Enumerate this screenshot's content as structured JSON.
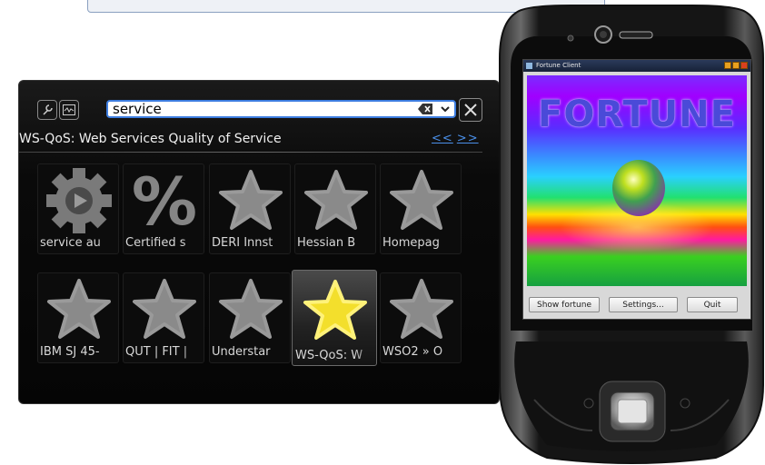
{
  "launcher": {
    "search_value": "service",
    "description": "WS-QoS: Web Services Quality of Service",
    "pager_prev": "<<",
    "pager_next": ">>",
    "items": [
      {
        "label": "service au",
        "icon": "gear-play"
      },
      {
        "label": "Certified s",
        "icon": "percent"
      },
      {
        "label": "DERI Innst",
        "icon": "star"
      },
      {
        "label": "Hessian B",
        "icon": "star"
      },
      {
        "label": "Homepag",
        "icon": "star"
      },
      {
        "label": "IBM SJ 45-",
        "icon": "star"
      },
      {
        "label": "QUT | FIT |",
        "icon": "star"
      },
      {
        "label": "Understar",
        "icon": "star"
      },
      {
        "label": "WS-QoS: W",
        "icon": "star",
        "selected": true
      },
      {
        "label": "WSO2 » O",
        "icon": "star"
      }
    ]
  },
  "phone": {
    "window_title": "Fortune Client",
    "art_title": "FORTUNE",
    "buttons": {
      "show_fortune": "Show fortune",
      "settings": "Settings...",
      "quit": "Quit"
    }
  },
  "colors": {
    "accent": "#3d7de0",
    "link": "#4a8fe8",
    "star_gray": "#8a8a8a",
    "star_yellow": "#f5e030"
  }
}
